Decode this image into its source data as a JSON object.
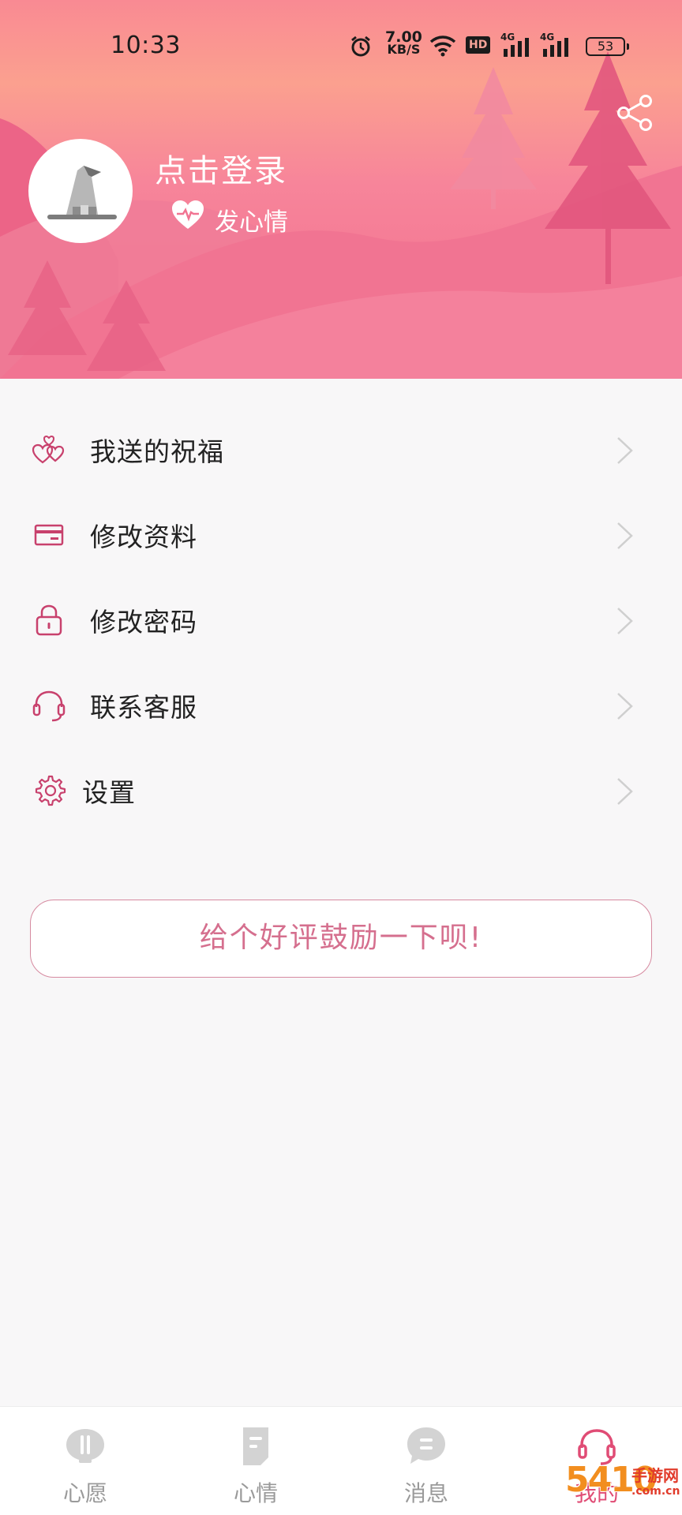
{
  "status_bar": {
    "time": "10:33",
    "net_speed_value": "7.00",
    "net_speed_unit": "KB/S",
    "hd_label": "HD",
    "signal_1_label": "4G",
    "signal_2_label": "4G",
    "battery": "53"
  },
  "header": {
    "login_label": "点击登录",
    "mood_label": "发心情"
  },
  "menu": {
    "items": [
      {
        "label": "我送的祝福",
        "icon": "hearts-icon"
      },
      {
        "label": "修改资料",
        "icon": "card-icon"
      },
      {
        "label": "修改密码",
        "icon": "lock-icon"
      },
      {
        "label": "联系客服",
        "icon": "headset-icon"
      },
      {
        "label": "设置",
        "icon": "gear-icon"
      }
    ]
  },
  "rate_button": "给个好评鼓励一下呗!",
  "bottom_nav": {
    "items": [
      {
        "label": "心愿",
        "icon": "wish-icon",
        "active": false
      },
      {
        "label": "心情",
        "icon": "note-icon",
        "active": false
      },
      {
        "label": "消息",
        "icon": "message-icon",
        "active": false
      },
      {
        "label": "我的",
        "icon": "headset-icon",
        "active": true
      }
    ]
  },
  "watermark": {
    "number": "5410",
    "site": "手游网",
    "domain": ".com.cn"
  },
  "colors": {
    "accent": "#e04c75",
    "header_top": "#f98a93",
    "header_bottom": "#f06b8e",
    "menu_icon": "#c8416d"
  }
}
